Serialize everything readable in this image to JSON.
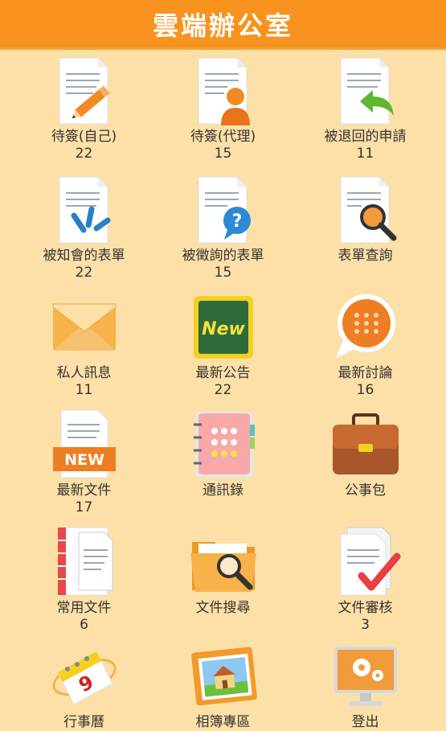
{
  "header": {
    "title": "雲端辦公室"
  },
  "colors": {
    "header": "#f7931e",
    "background": "#fde0a8",
    "accent_orange": "#ef7d22",
    "text": "#333333"
  },
  "items": [
    {
      "label": "待簽(自己)",
      "count": "22",
      "icon": "doc-pencil-icon"
    },
    {
      "label": "待簽(代理)",
      "count": "15",
      "icon": "doc-person-icon"
    },
    {
      "label": "被退回的申請",
      "count": "11",
      "icon": "doc-return-arrow-icon"
    },
    {
      "label": "被知會的表單",
      "count": "22",
      "icon": "doc-notify-icon"
    },
    {
      "label": "被徵詢的表單",
      "count": "15",
      "icon": "doc-question-icon"
    },
    {
      "label": "表單查詢",
      "count": "",
      "icon": "doc-search-icon"
    },
    {
      "label": "私人訊息",
      "count": "11",
      "icon": "envelope-icon"
    },
    {
      "label": "最新公告",
      "count": "22",
      "icon": "new-board-icon"
    },
    {
      "label": "最新討論",
      "count": "16",
      "icon": "chat-bubble-icon"
    },
    {
      "label": "最新文件",
      "count": "17",
      "icon": "new-document-icon"
    },
    {
      "label": "通訊錄",
      "count": "",
      "icon": "address-book-icon"
    },
    {
      "label": "公事包",
      "count": "",
      "icon": "briefcase-icon"
    },
    {
      "label": "常用文件",
      "count": "6",
      "icon": "binder-document-icon"
    },
    {
      "label": "文件搜尋",
      "count": "",
      "icon": "folder-search-icon"
    },
    {
      "label": "文件審核",
      "count": "3",
      "icon": "doc-check-icon"
    },
    {
      "label": "行事曆",
      "count": "",
      "icon": "calendar-icon"
    },
    {
      "label": "相簿專區",
      "count": "",
      "icon": "photo-album-icon"
    },
    {
      "label": "登出",
      "count": "",
      "icon": "logout-monitor-icon"
    }
  ]
}
